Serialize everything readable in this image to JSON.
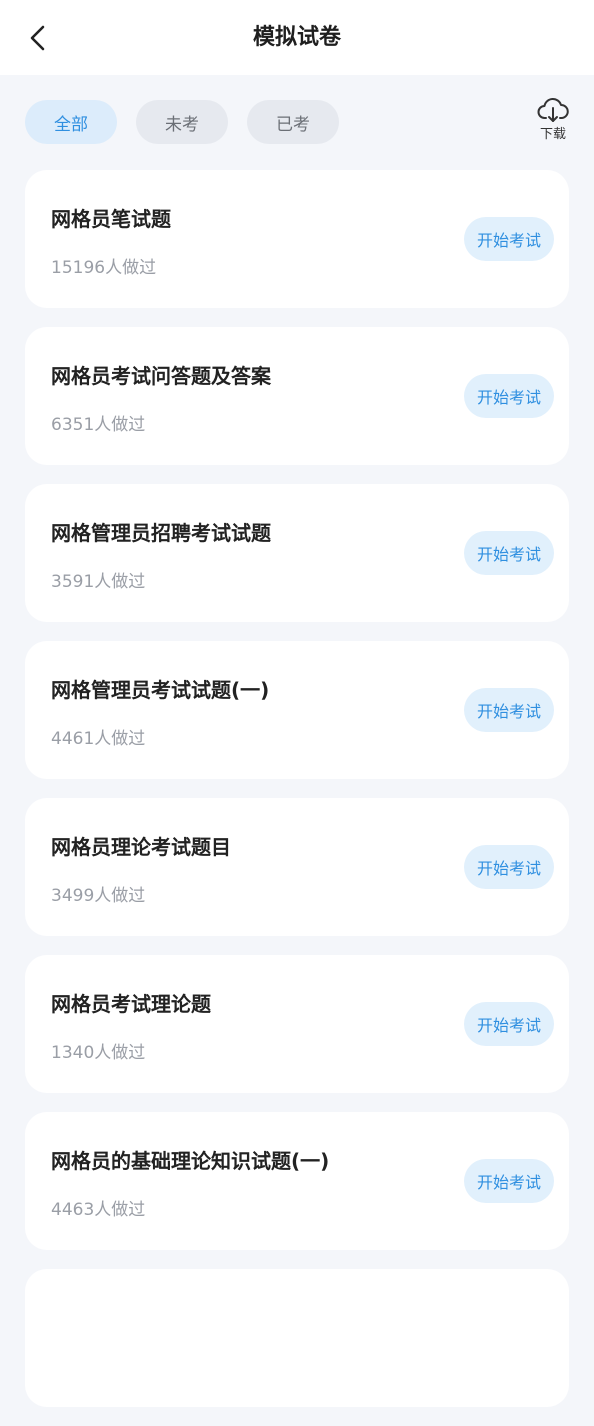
{
  "header": {
    "title": "模拟试卷",
    "back_icon": "chevron-left-icon"
  },
  "filters": {
    "tabs": [
      {
        "label": "全部",
        "active": true
      },
      {
        "label": "未考",
        "active": false
      },
      {
        "label": "已考",
        "active": false
      }
    ],
    "download_label": "下载",
    "download_icon": "cloud-download-icon"
  },
  "exams": [
    {
      "title": "网格员笔试题",
      "count": "15196人做过",
      "action": "开始考试"
    },
    {
      "title": "网格员考试问答题及答案",
      "count": "6351人做过",
      "action": "开始考试"
    },
    {
      "title": "网格管理员招聘考试试题",
      "count": "3591人做过",
      "action": "开始考试"
    },
    {
      "title": "网格管理员考试试题(一)",
      "count": "4461人做过",
      "action": "开始考试"
    },
    {
      "title": "网格员理论考试题目",
      "count": "3499人做过",
      "action": "开始考试"
    },
    {
      "title": "网格员考试理论题",
      "count": "1340人做过",
      "action": "开始考试"
    },
    {
      "title": "网格员的基础理论知识试题(一)",
      "count": "4463人做过",
      "action": "开始考试"
    },
    {
      "title": "",
      "count": "",
      "action": ""
    }
  ],
  "colors": {
    "accent": "#2f8fe0",
    "active_pill_bg": "#dcecfb",
    "background": "#f4f6fa"
  }
}
